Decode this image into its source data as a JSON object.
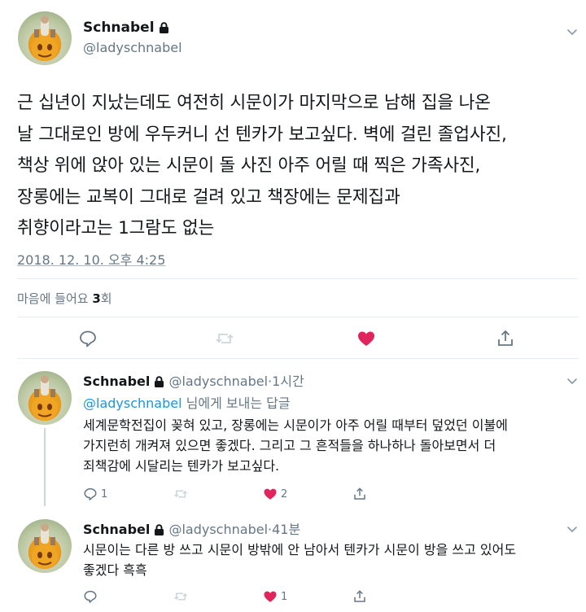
{
  "main_tweet": {
    "display_name": "Schnabel",
    "handle": "@ladyschnabel",
    "lines": [
      "근 십년이 지났는데도 여전히 시문이가 마지막으로 남해 집을 나온",
      "날 그대로인 방에 우두커니 선 텐카가 보고싶다. 벽에 걸린 졸업사진,",
      "책상 위에 앉아 있는 시문이 돌 사진 아주 어릴 때 찍은 가족사진,",
      "장롱에는 교복이 그대로 걸려 있고 책장에는 문제집과",
      "취향이라고는 1그람도 없는"
    ],
    "timestamp": "2018. 12. 10. 오후 4:25",
    "likes_prefix": "마음에 들어요",
    "likes_count": "3",
    "likes_suffix": "회"
  },
  "replies": [
    {
      "display_name": "Schnabel",
      "handle": "@ladyschnabel",
      "time": "·1시간",
      "reply_to_mention": "@ladyschnabel",
      "reply_to_suffix": " 님에게 보내는 답글",
      "lines": [
        "세계문학전집이 꽂혀 있고, 장롱에는 시문이가 아주 어릴 때부터 덮었던 이불에",
        "가지런히 개켜져 있으면 좋겠다. 그리고 그 흔적들을 하나하나 돌아보면서 더",
        "죄책감에 시달리는 텐카가 보고싶다."
      ],
      "reply_count": "1",
      "like_count": "2"
    },
    {
      "display_name": "Schnabel",
      "handle": "@ladyschnabel",
      "time": "·41분",
      "lines": [
        "시문이는 다른 방 쓰고 시문이 방밖에 안 남아서 텐카가 시문이 방을 쓰고 있어도",
        "좋겠다 흑흑"
      ],
      "like_count": "1"
    }
  ],
  "colors": {
    "text": "#14171a",
    "secondary": "#657786",
    "link": "#1b95e0",
    "like": "#e0245e",
    "divider": "#e6ecf0"
  },
  "icons": [
    "lock-icon",
    "chevron-down-icon",
    "reply-icon",
    "retweet-icon",
    "like-icon",
    "share-icon"
  ]
}
